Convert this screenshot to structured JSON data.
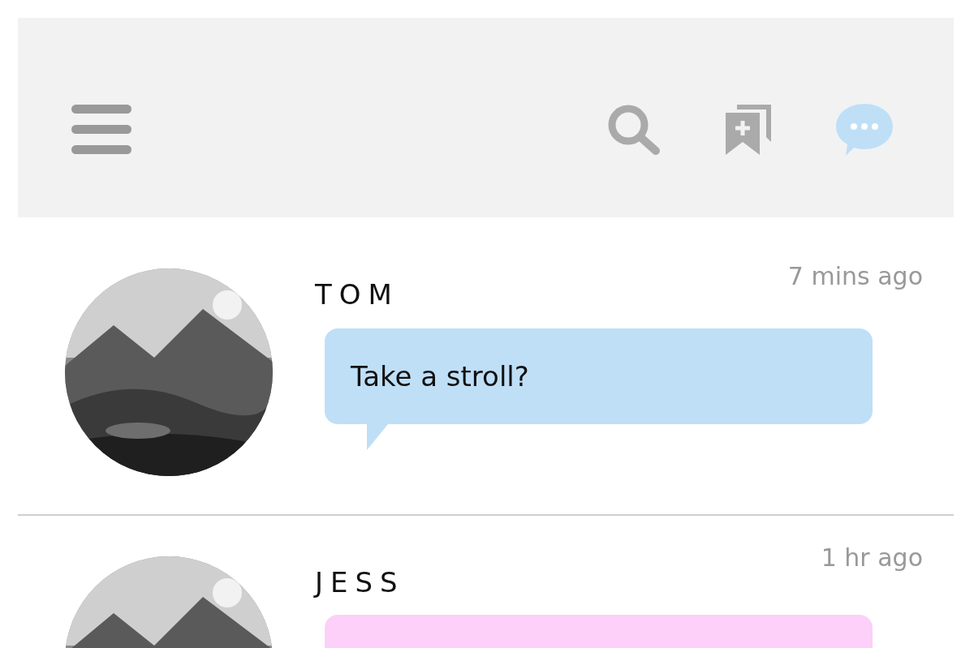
{
  "nav": [
    {
      "kind": "search",
      "selected": false
    },
    {
      "kind": "bookmark",
      "selected": false
    },
    {
      "kind": "chat",
      "selected": true
    }
  ],
  "conversations": [
    {
      "name": "TOM",
      "time": "7 mins ago",
      "message": "Take a stroll?",
      "color": "#bfdff7"
    },
    {
      "name": "JESS",
      "time": "1 hr ago",
      "color": "#fcd0f8"
    }
  ]
}
